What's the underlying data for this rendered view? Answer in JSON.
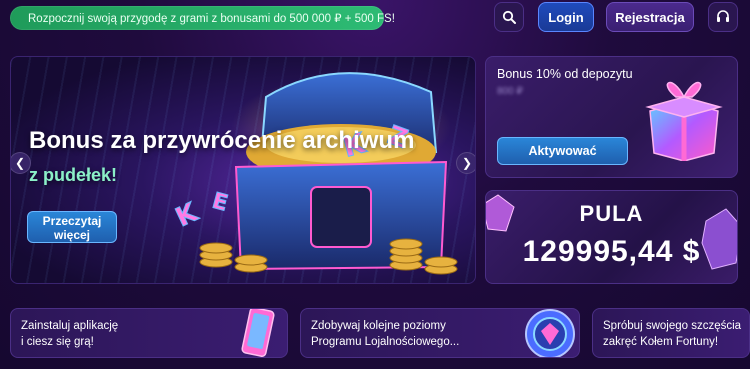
{
  "topbar": {
    "promo_text": "Rozpocznij swoją przygodę z grami z bonusami do 500 000 ₽ + 500 FS!",
    "login_label": "Login",
    "register_label": "Rejestracja"
  },
  "banner": {
    "title": "Bonus za przywrócenie archiwum",
    "subtitle": "z pudełek!",
    "button_label_line1": "Przeczytaj",
    "button_label_line2": "więcej",
    "prev_icon": "chevron-left-icon",
    "next_icon": "chevron-right-icon"
  },
  "deposit_card": {
    "title": "Bonus 10% od depozytu",
    "blurred_amount": "800 ₽",
    "button_label": "Aktywować"
  },
  "jackpot": {
    "label": "PULA",
    "value": "129995,44 $"
  },
  "bottom_cards": [
    {
      "line1": "Zainstaluj aplikację",
      "line2": "i ciesz się grą!"
    },
    {
      "line1": "Zdobywaj kolejne poziomy",
      "line2": "Programu Lojalnościowego..."
    },
    {
      "line1": "Spróbuj swojego szczęścia",
      "line2": "zakręć Kołem Fortuny!"
    }
  ],
  "colors": {
    "background": "#1f0b3d",
    "promo_green": "#2dbb74",
    "accent_blue": "#2a86d8",
    "subtitle_mint": "#8bf0c8"
  }
}
